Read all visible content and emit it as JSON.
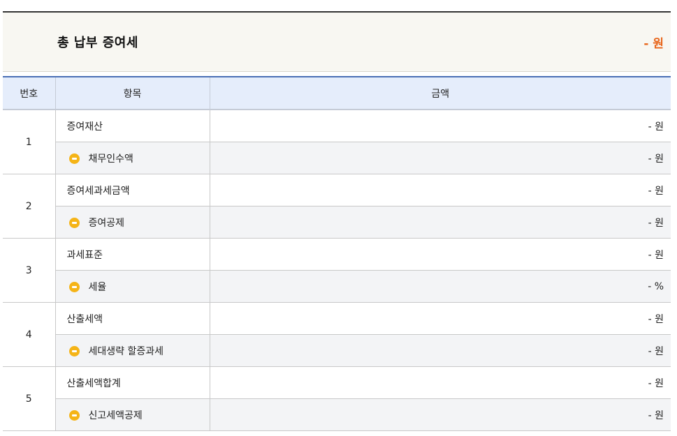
{
  "summary": {
    "title": "총 납부 증여세",
    "amount": "- 원"
  },
  "table": {
    "headers": [
      "번호",
      "항목",
      "금액"
    ],
    "groups": [
      {
        "number": "1",
        "main_label": "증여재산",
        "main_value": "- 원",
        "sub_label": "채무인수액",
        "sub_value": "- 원"
      },
      {
        "number": "2",
        "main_label": "증여세과세금액",
        "main_value": "- 원",
        "sub_label": "증여공제",
        "sub_value": "- 원"
      },
      {
        "number": "3",
        "main_label": "과세표준",
        "main_value": "- 원",
        "sub_label": "세율",
        "sub_value": "- %"
      },
      {
        "number": "4",
        "main_label": "산출세액",
        "main_value": "- 원",
        "sub_label": "세대생략 할증과세",
        "sub_value": "- 원"
      },
      {
        "number": "5",
        "main_label": "산출세액합계",
        "main_value": "- 원",
        "sub_label": "신고세액공제",
        "sub_value": "- 원"
      }
    ]
  },
  "colors": {
    "accent_orange": "#e8651a",
    "minus_icon": "#f5b417",
    "header_bg": "#e5edfb",
    "header_border": "#4a6fb5"
  },
  "icons": {
    "sub_row": "minus-circle-icon"
  }
}
